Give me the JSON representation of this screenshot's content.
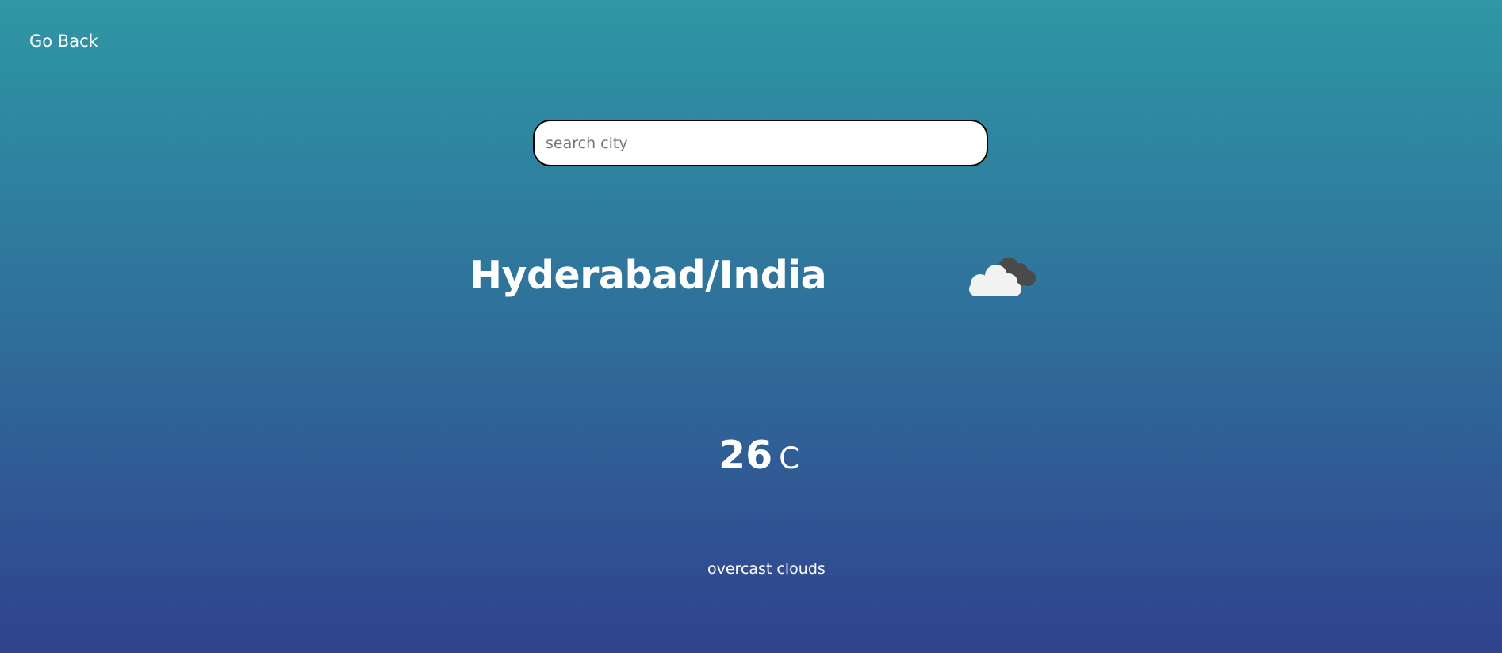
{
  "nav": {
    "back_label": "Go Back"
  },
  "search": {
    "placeholder": "search city",
    "value": ""
  },
  "weather": {
    "location": "Hyderabad/India",
    "icon": "overcast-clouds-icon",
    "temperature": "26",
    "unit": "C",
    "description": "overcast clouds"
  },
  "colors": {
    "background_top": "#2e97a5",
    "background_bottom": "#30428e",
    "text": "#ffffff"
  }
}
